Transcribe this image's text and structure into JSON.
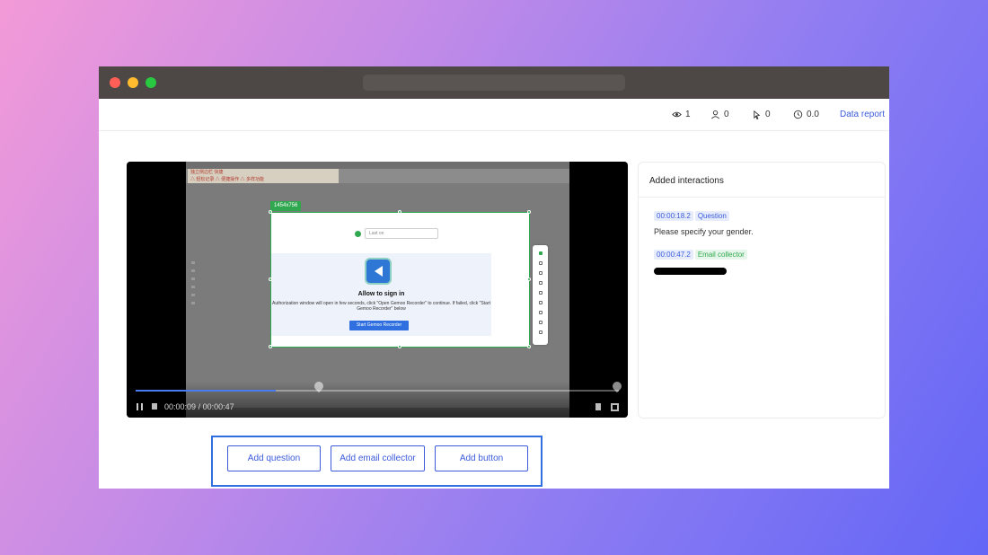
{
  "stats": {
    "views": "1",
    "users": "0",
    "clicks": "0",
    "time": "0.0",
    "data_report": "Data report"
  },
  "video": {
    "size_tag": "1454x756",
    "field_placeholder": "Last on",
    "dialog_title": "Allow to sign in",
    "dialog_text": "Authorization window will open in few seconds, click \"Open Gemoo Recorder\" to continue. If failed, click \"Start Gemoo Recorder\" below",
    "dialog_button": "Start Gemoo Recorder",
    "time_current": "00:00:09",
    "time_sep": "/",
    "time_total": "00:00:47",
    "progress": 0.29,
    "ad_text_1": "独立侧边栏 快捷",
    "ad_text_2": "△ 轻松记录 △ 便捷操作 △ 多样功能"
  },
  "side_panel": {
    "title": "Added interactions",
    "items": [
      {
        "time": "00:00:18.2",
        "type": "Question",
        "text": "Please specify your gender."
      },
      {
        "time": "00:00:47.2",
        "type": "Email collector"
      }
    ]
  },
  "actions": {
    "add_question": "Add question",
    "add_email": "Add email collector",
    "add_button": "Add button"
  },
  "colors": {
    "accent": "#3b5bdb",
    "green": "#2fa84f"
  }
}
